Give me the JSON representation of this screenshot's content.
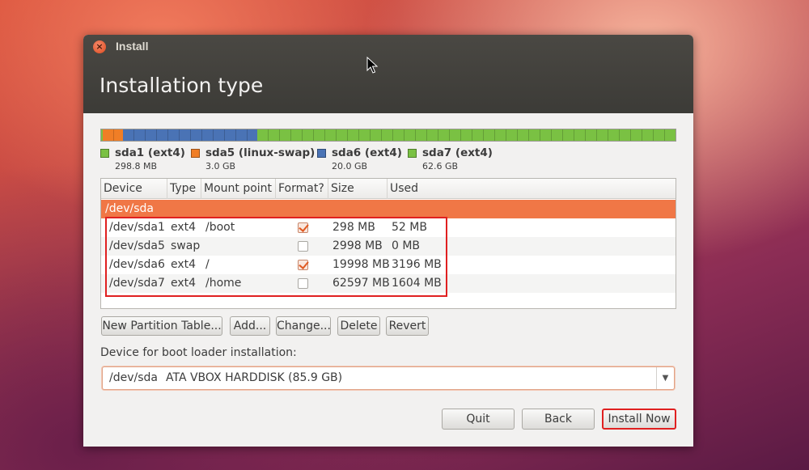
{
  "window": {
    "title": "Install",
    "close_icon": "close-icon"
  },
  "page": {
    "title": "Installation type"
  },
  "partition_bar": {
    "segments": [
      {
        "name": "sda1 (ext4)",
        "color": "#7ac143",
        "size_mb": 298.8
      },
      {
        "name": "sda5 (linux-swap)",
        "color": "#f07e26",
        "size_mb": 3000
      },
      {
        "name": "sda6 (ext4)",
        "color": "#4a73b5",
        "size_mb": 20000
      },
      {
        "name": "sda7 (ext4)",
        "color": "#7ac143",
        "size_mb": 62600
      }
    ]
  },
  "legend": [
    {
      "name": "sda1 (ext4)",
      "size": "298.8 MB",
      "color": "#7ac143"
    },
    {
      "name": "sda5 (linux-swap)",
      "size": "3.0 GB",
      "color": "#f07e26"
    },
    {
      "name": "sda6 (ext4)",
      "size": "20.0 GB",
      "color": "#4a73b5"
    },
    {
      "name": "sda7 (ext4)",
      "size": "62.6 GB",
      "color": "#7ac143"
    }
  ],
  "table": {
    "columns": [
      "Device",
      "Type",
      "Mount point",
      "Format?",
      "Size",
      "Used"
    ],
    "disk": "/dev/sda",
    "rows": [
      {
        "device": "/dev/sda1",
        "type": "ext4",
        "mount": "/boot",
        "format": true,
        "size": "298 MB",
        "used": "52 MB"
      },
      {
        "device": "/dev/sda5",
        "type": "swap",
        "mount": "",
        "format": false,
        "size": "2998 MB",
        "used": "0 MB"
      },
      {
        "device": "/dev/sda6",
        "type": "ext4",
        "mount": "/",
        "format": true,
        "size": "19998 MB",
        "used": "3196 MB"
      },
      {
        "device": "/dev/sda7",
        "type": "ext4",
        "mount": "/home",
        "format": false,
        "size": "62597 MB",
        "used": "1604 MB"
      }
    ]
  },
  "buttons": {
    "new_table": "New Partition Table...",
    "add": "Add...",
    "change": "Change...",
    "delete": "Delete",
    "revert": "Revert"
  },
  "bootloader": {
    "label": "Device for boot loader installation:",
    "device": "/dev/sda",
    "description": "ATA VBOX HARDDISK (85.9 GB)"
  },
  "footer": {
    "quit": "Quit",
    "back": "Back",
    "install": "Install Now"
  },
  "colors": {
    "accent": "#f07746",
    "highlight_box": "#e02020",
    "titlebar": "#3c3b37"
  }
}
